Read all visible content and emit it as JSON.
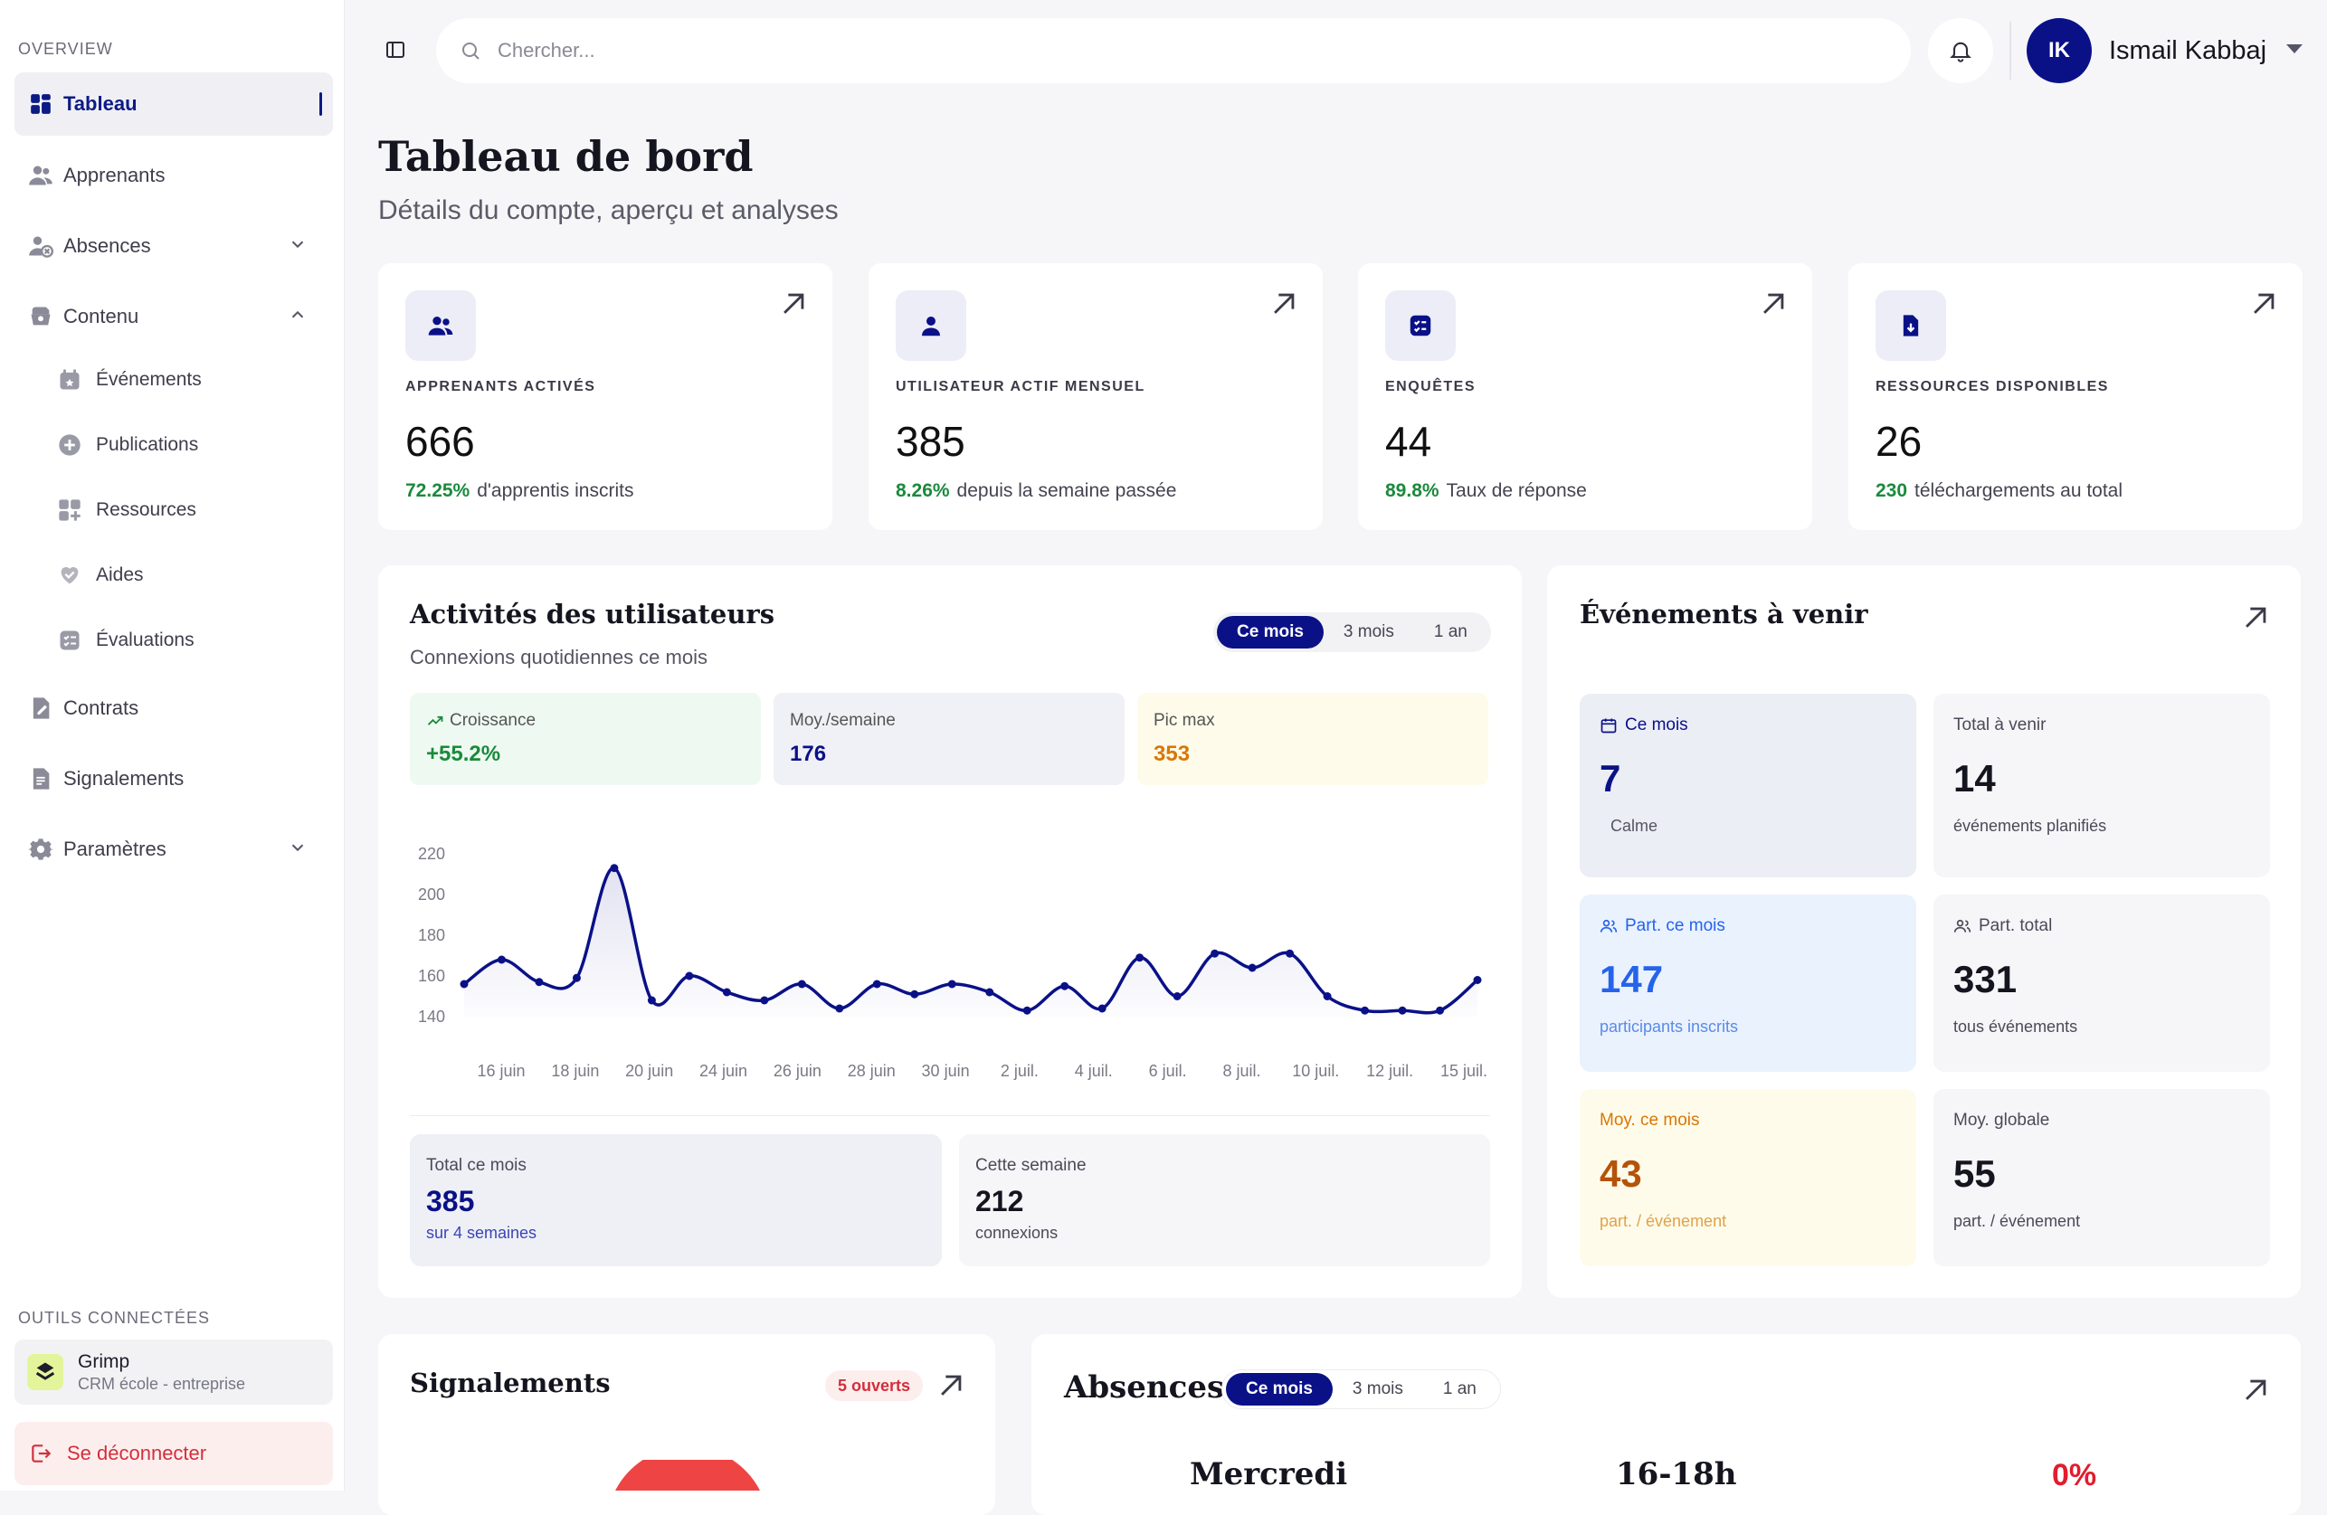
{
  "sidebar": {
    "section_overview": "OVERVIEW",
    "items": [
      {
        "label": "Tableau",
        "icon": "dashboard-icon"
      },
      {
        "label": "Apprenants",
        "icon": "users-icon"
      },
      {
        "label": "Absences",
        "icon": "user-absent-icon"
      },
      {
        "label": "Contenu",
        "icon": "content-icon"
      },
      {
        "label": "Contrats",
        "icon": "contract-icon"
      },
      {
        "label": "Signalements",
        "icon": "report-icon"
      },
      {
        "label": "Paramètres",
        "icon": "gear-icon"
      }
    ],
    "sub_items": [
      {
        "label": "Événements",
        "icon": "calendar-icon"
      },
      {
        "label": "Publications",
        "icon": "plus-circle-icon"
      },
      {
        "label": "Ressources",
        "icon": "grid-plus-icon"
      },
      {
        "label": "Aides",
        "icon": "heart-hand-icon"
      },
      {
        "label": "Évaluations",
        "icon": "checklist-icon"
      }
    ],
    "section_tools": "OUTILS CONNECTÉES",
    "tool": {
      "name": "Grimp",
      "sub": "CRM école - entreprise"
    },
    "logout": "Se déconnecter"
  },
  "topbar": {
    "search_placeholder": "Chercher...",
    "user_initials": "IK",
    "user_name": "Ismail Kabbaj"
  },
  "page": {
    "title": "Tableau de bord",
    "subtitle": "Détails du compte, aperçu et analyses"
  },
  "kpis": [
    {
      "label": "APPRENANTS ACTIVÉS",
      "value": "666",
      "pct": "72.25%",
      "foot": "d'apprentis inscrits"
    },
    {
      "label": "UTILISATEUR ACTIF MENSUEL",
      "value": "385",
      "pct": "8.26%",
      "foot": "depuis la semaine passée"
    },
    {
      "label": "ENQUÊTES",
      "value": "44",
      "pct": "89.8%",
      "foot": "Taux de réponse"
    },
    {
      "label": "RESSOURCES DISPONIBLES",
      "value": "26",
      "pct": "230",
      "foot": "téléchargements au total"
    }
  ],
  "activity": {
    "title": "Activités des utilisateurs",
    "subtitle": "Connexions quotidiennes ce mois",
    "tabs": [
      "Ce mois",
      "3 mois",
      "1 an"
    ],
    "growth_label": "Croissance",
    "growth_value": "+55.2%",
    "avg_label": "Moy./semaine",
    "avg_value": "176",
    "peak_label": "Pic max",
    "peak_value": "353",
    "total_label": "Total ce mois",
    "total_value": "385",
    "total_sub": "sur 4 semaines",
    "week_label": "Cette semaine",
    "week_value": "212",
    "week_sub": "connexions"
  },
  "chart_data": {
    "type": "line",
    "title": "",
    "xlabel": "",
    "ylabel": "",
    "ylim": [
      140,
      220
    ],
    "y_ticks": [
      140,
      160,
      180,
      200,
      220
    ],
    "x_tick_labels": [
      "16 juin",
      "18 juin",
      "20 juin",
      "24 juin",
      "26 juin",
      "28 juin",
      "30 juin",
      "2 juil.",
      "4 juil.",
      "6 juil.",
      "8 juil.",
      "10 juil.",
      "12 juil.",
      "15 juil."
    ],
    "series": [
      {
        "values": [
          156,
          168,
          157,
          159,
          213,
          148,
          160,
          152,
          148,
          156,
          144,
          156,
          151,
          156,
          152,
          143,
          155,
          144,
          169,
          150,
          171,
          164,
          171,
          150,
          143,
          143,
          143,
          158
        ],
        "color": "#0a1187"
      }
    ],
    "grid": false,
    "legend": "none"
  },
  "events": {
    "title": "Événements à venir",
    "cards": [
      {
        "label": "Ce mois",
        "value": "7",
        "sub": "Calme"
      },
      {
        "label": "Total à venir",
        "value": "14",
        "sub": "événements planifiés"
      },
      {
        "label": "Part. ce mois",
        "value": "147",
        "sub": "participants inscrits"
      },
      {
        "label": "Part. total",
        "value": "331",
        "sub": "tous événements"
      },
      {
        "label": "Moy. ce mois",
        "value": "43",
        "sub": "part. / événement"
      },
      {
        "label": "Moy. globale",
        "value": "55",
        "sub": "part. / événement"
      }
    ]
  },
  "reports": {
    "title": "Signalements",
    "badge": "5 ouverts"
  },
  "absences": {
    "title": "Absences",
    "tabs": [
      "Ce mois",
      "3 mois",
      "1 an"
    ],
    "day": "Mercredi",
    "slot": "16-18h",
    "rate": "0%"
  },
  "colors": {
    "brand": "#0a1187",
    "green": "#1a8a3c",
    "orange": "#d97706",
    "red": "#d32f3b"
  }
}
